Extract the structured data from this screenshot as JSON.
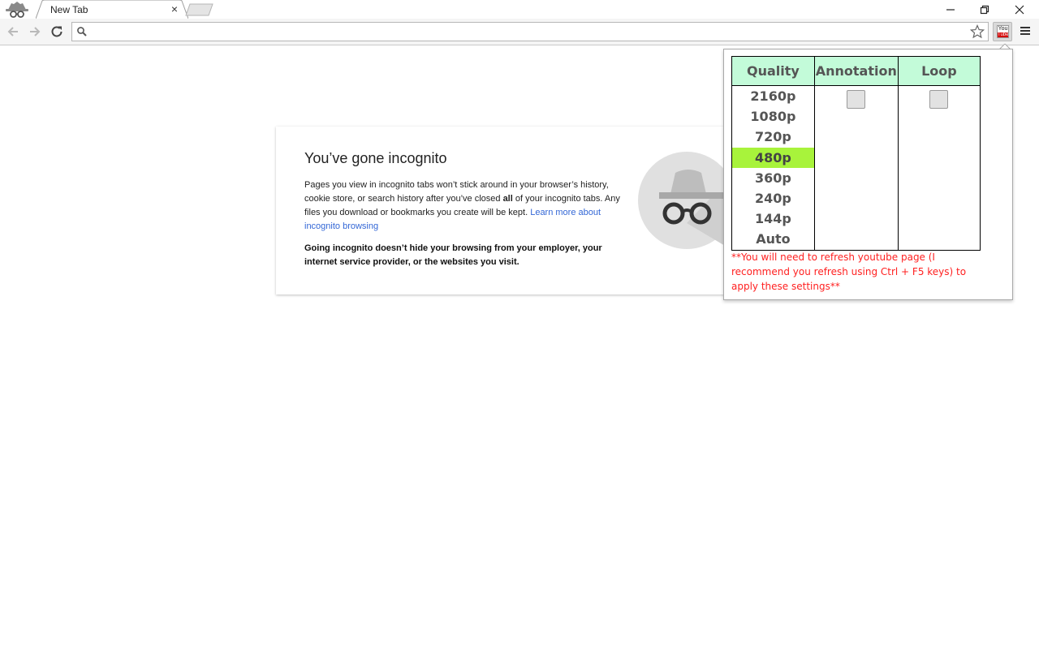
{
  "browser": {
    "tab": {
      "title": "New Tab",
      "close_glyph": "×"
    },
    "omnibox": {
      "value": "",
      "placeholder": ""
    },
    "colors": {
      "toolbar_bg": "#f5f5f5",
      "link": "#3367d6"
    },
    "extension_icon": {
      "top": "You",
      "bottom": "Tube"
    }
  },
  "incognito_page": {
    "title": "You’ve gone incognito",
    "body_part1": "Pages you view in incognito tabs won’t stick around in your browser’s history, cookie store, or search history after you’ve closed ",
    "body_bold": "all",
    "body_part2": " of your incognito tabs. Any files you download or bookmarks you create will be kept. ",
    "link": "Learn more about incognito browsing",
    "warning": "Going incognito doesn’t hide your browsing from your employer, your internet service provider, or the websites you visit."
  },
  "popup": {
    "headers": {
      "quality": "Quality",
      "annotation": "Annotation",
      "loop": "Loop"
    },
    "qualities": [
      "2160p",
      "1080p",
      "720p",
      "480p",
      "360p",
      "240p",
      "144p",
      "Auto"
    ],
    "selected_quality": "480p",
    "annotation_checked": false,
    "loop_checked": false,
    "note": "**You will need to refresh youtube page (I recommend you refresh using Ctrl + F5 keys) to apply these settings**",
    "colors": {
      "header_bg": "#c3fbd9",
      "selected_bg": "#a8f33b",
      "note": "#ff2020"
    }
  }
}
